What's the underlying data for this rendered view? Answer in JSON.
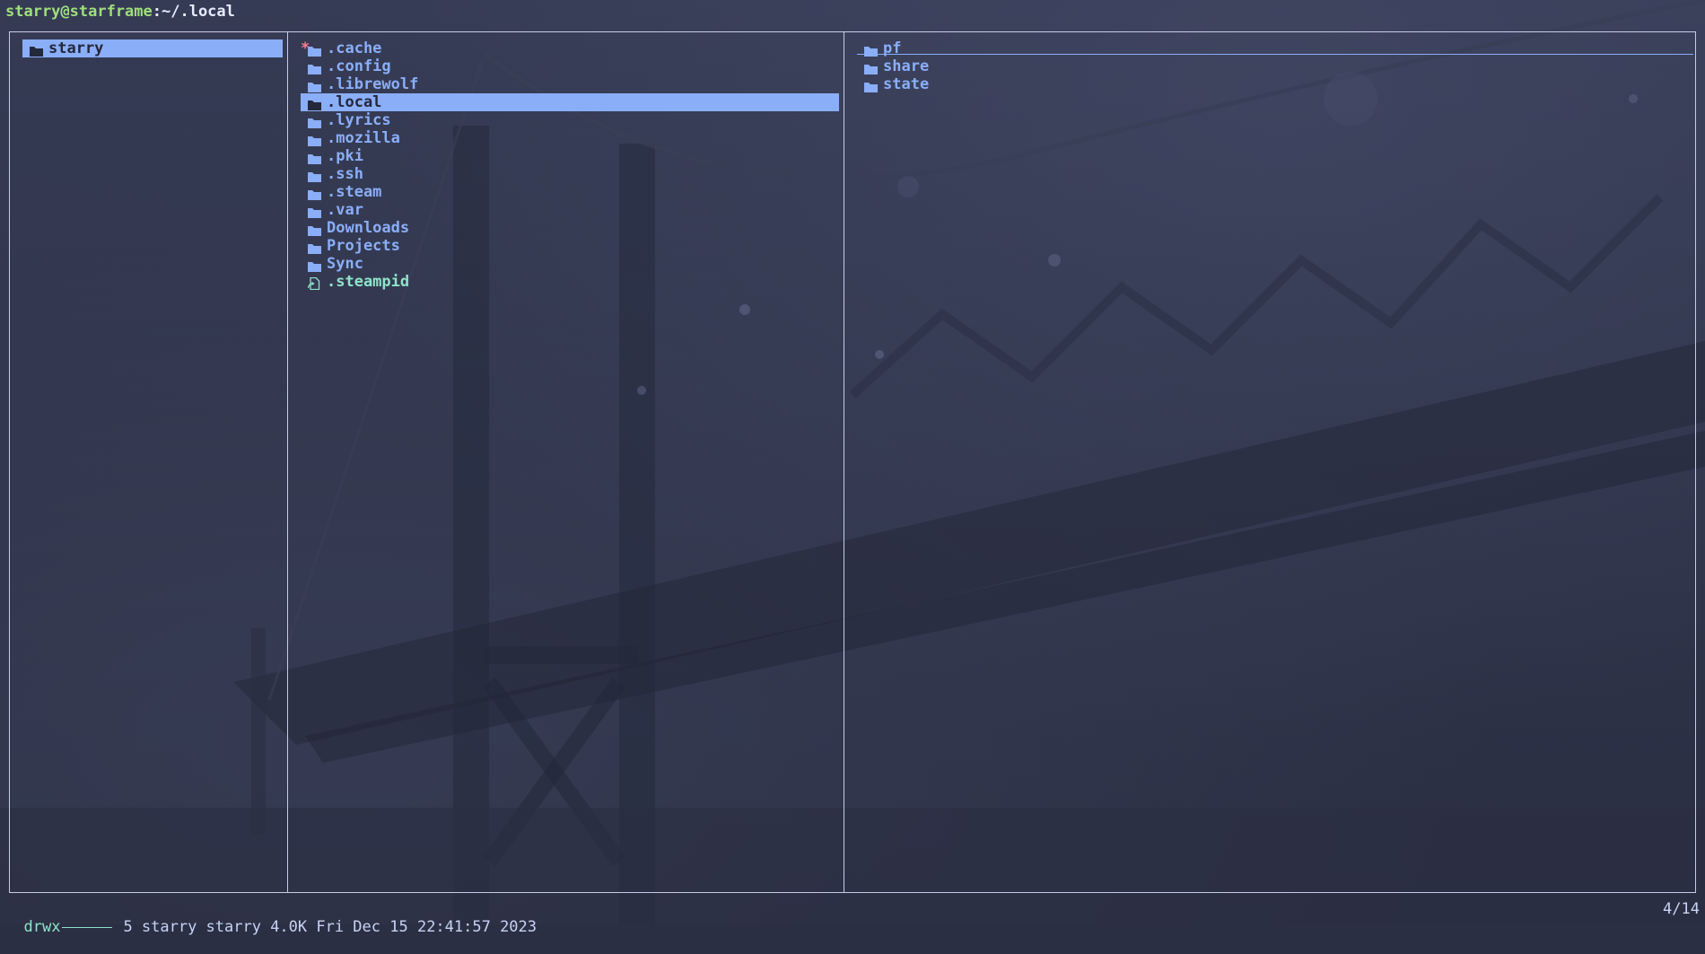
{
  "title": {
    "user_host": "starry@starframe",
    "path": ":~/.local"
  },
  "parent": {
    "items": [
      {
        "label": "starry",
        "type": "folder",
        "selected": true
      }
    ]
  },
  "current": {
    "items": [
      {
        "label": ".cache",
        "type": "folder",
        "marker": "*"
      },
      {
        "label": ".config",
        "type": "folder"
      },
      {
        "label": ".librewolf",
        "type": "folder"
      },
      {
        "label": ".local",
        "type": "folder",
        "selected": true
      },
      {
        "label": ".lyrics",
        "type": "folder"
      },
      {
        "label": ".mozilla",
        "type": "folder"
      },
      {
        "label": ".pki",
        "type": "folder"
      },
      {
        "label": ".ssh",
        "type": "folder"
      },
      {
        "label": ".steam",
        "type": "folder"
      },
      {
        "label": ".var",
        "type": "folder"
      },
      {
        "label": "Downloads",
        "type": "folder"
      },
      {
        "label": "Projects",
        "type": "folder"
      },
      {
        "label": "Sync",
        "type": "folder"
      },
      {
        "label": ".steampid",
        "type": "symlink"
      }
    ]
  },
  "preview": {
    "items": [
      {
        "label": "pf",
        "type": "folder"
      },
      {
        "label": "share",
        "type": "folder"
      },
      {
        "label": "state",
        "type": "folder"
      }
    ]
  },
  "status": {
    "permissions": "drwx",
    "meta": "5 starry starry 4.0K Fri Dec 15 22:41:57 2023",
    "position": "4/14"
  },
  "colors": {
    "accent": "#8aaef8",
    "selected_text": "#24283b",
    "file": "#8fe3c9",
    "marker": "#ff7a93",
    "prompt_user": "#9ee07a"
  },
  "icons": {
    "folder": "folder-icon",
    "symlink": "symlink-file-icon"
  }
}
